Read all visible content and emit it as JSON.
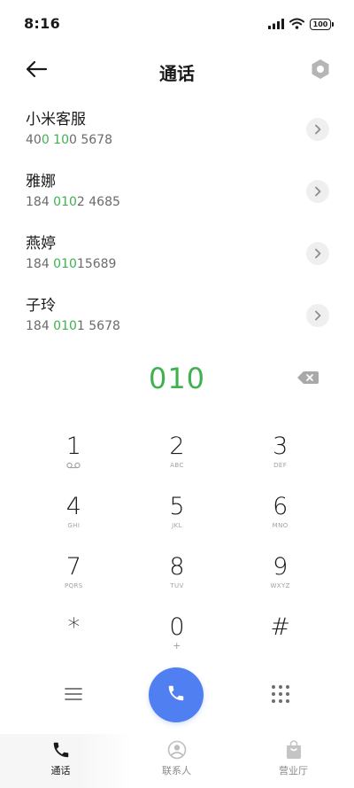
{
  "status_bar": {
    "time": "8:16",
    "battery": "100",
    "icons": [
      "signal-icon",
      "wifi-icon",
      "battery-icon"
    ]
  },
  "header": {
    "title": "通话",
    "back_icon": "back-arrow-icon",
    "settings_icon": "settings-hexagon-icon"
  },
  "contacts": [
    {
      "name": "小米客服",
      "number_pre": "40",
      "number_match": "0 10",
      "number_post": "0 5678"
    },
    {
      "name": "雅娜",
      "number_pre": "184 ",
      "number_match": "010",
      "number_post": "2 4685"
    },
    {
      "name": "燕婷",
      "number_pre": "184 ",
      "number_match": "010",
      "number_post": "15689"
    },
    {
      "name": "子玲",
      "number_pre": "184 ",
      "number_match": "010",
      "number_post": "1 5678"
    }
  ],
  "dialer": {
    "input": "010"
  },
  "keypad": [
    {
      "digit": "1",
      "letters": ""
    },
    {
      "digit": "2",
      "letters": "ABC"
    },
    {
      "digit": "3",
      "letters": "DEF"
    },
    {
      "digit": "4",
      "letters": "GHI"
    },
    {
      "digit": "5",
      "letters": "JKL"
    },
    {
      "digit": "6",
      "letters": "MNO"
    },
    {
      "digit": "7",
      "letters": "PQRS"
    },
    {
      "digit": "8",
      "letters": "TUV"
    },
    {
      "digit": "9",
      "letters": "WXYZ"
    },
    {
      "digit": "*",
      "letters": ""
    },
    {
      "digit": "0",
      "letters": "+"
    },
    {
      "digit": "#",
      "letters": ""
    }
  ],
  "tabs": [
    {
      "label": "通话",
      "icon": "phone-icon",
      "active": true
    },
    {
      "label": "联系人",
      "icon": "contact-icon",
      "active": false
    },
    {
      "label": "营业厅",
      "icon": "shopping-bag-icon",
      "active": false
    }
  ],
  "colors": {
    "accent_green": "#3fb24f",
    "call_button_blue": "#4f7ff0"
  }
}
